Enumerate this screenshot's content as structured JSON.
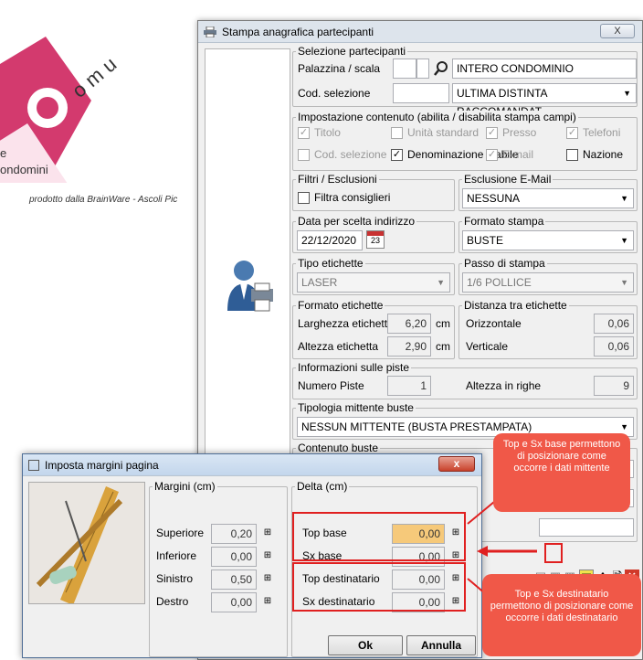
{
  "background": {
    "logo_letters": "o m u",
    "brand": "ondomini",
    "brand_prefix": "e",
    "tagline": "prodotto dalla BrainWare - Ascoli Pic"
  },
  "window": {
    "title": "Stampa anagrafica partecipanti",
    "close": "X"
  },
  "selezione": {
    "legend": "Selezione partecipanti",
    "palazzina_label": "Palazzina / scala",
    "palazzina_value": "INTERO CONDOMINIO",
    "cod_label": "Cod. selezione",
    "cod_value": "ULTIMA DISTINTA RACCOMANDAT"
  },
  "impostazione": {
    "legend": "Impostazione contenuto (abilita / disabilita stampa campi)",
    "items": [
      {
        "label": "Titolo",
        "checked": true,
        "enabled": false
      },
      {
        "label": "Unità standard",
        "checked": false,
        "enabled": false
      },
      {
        "label": "Presso",
        "checked": true,
        "enabled": false
      },
      {
        "label": "Telefoni",
        "checked": true,
        "enabled": false
      },
      {
        "label": "Cod. selezione",
        "checked": false,
        "enabled": false
      },
      {
        "label": "Denominazione stabile",
        "checked": true,
        "enabled": true
      },
      {
        "label": "E-mail",
        "checked": true,
        "enabled": false
      },
      {
        "label": "Nazione",
        "checked": false,
        "enabled": true
      }
    ]
  },
  "filtri": {
    "legend": "Filtri / Esclusioni",
    "consiglieri": "Filtra consiglieri"
  },
  "esclusione": {
    "legend": "Esclusione E-Mail",
    "value": "NESSUNA"
  },
  "data": {
    "legend": "Data per scelta indirizzo",
    "value": "22/12/2020",
    "cal": "23"
  },
  "formato_stampa": {
    "legend": "Formato stampa",
    "value": "BUSTE"
  },
  "tipo_etichette": {
    "legend": "Tipo etichette",
    "value": "LASER"
  },
  "passo": {
    "legend": "Passo di stampa",
    "value": "1/6 POLLICE"
  },
  "formato_etichette": {
    "legend": "Formato etichette",
    "larghezza_label": "Larghezza etichetta",
    "larghezza": "6,20",
    "altezza_label": "Altezza etichetta",
    "altezza": "2,90",
    "unit": "cm"
  },
  "distanza": {
    "legend": "Distanza tra etichette",
    "orizzontale_label": "Orizzontale",
    "orizzontale": "0,06",
    "verticale_label": "Verticale",
    "verticale": "0,06"
  },
  "piste": {
    "legend": "Informazioni sulle piste",
    "numero_label": "Numero Piste",
    "numero": "1",
    "altezza_label": "Altezza in righe",
    "altezza": "9"
  },
  "tipologia": {
    "legend": "Tipologia mittente buste",
    "value": "NESSUN MITTENTE (BUSTA PRESTAMPATA)"
  },
  "contenuto": {
    "legend": "Contenuto buste"
  },
  "dialog": {
    "title": "Imposta margini pagina",
    "close": "x",
    "margini_legend": "Margini (cm)",
    "margini": [
      {
        "label": "Superiore",
        "value": "0,20"
      },
      {
        "label": "Inferiore",
        "value": "0,00"
      },
      {
        "label": "Sinistro",
        "value": "0,50"
      },
      {
        "label": "Destro",
        "value": "0,00"
      }
    ],
    "delta_legend": "Delta (cm)",
    "delta": [
      {
        "label": "Top base",
        "value": "0,00"
      },
      {
        "label": "Sx base",
        "value": "0,00"
      },
      {
        "label": "Top destinatario",
        "value": "0,00"
      },
      {
        "label": "Sx destinatario",
        "value": "0,00"
      }
    ],
    "ok": "Ok",
    "annulla": "Annulla"
  },
  "callouts": {
    "top": "Top e Sx base permettono di posizionare come occorre i dati mittente",
    "bottom": "Top e Sx destinatario permettono di posizionare come occorre i dati destinatario"
  },
  "colors": {
    "accent_red": "#e02020",
    "callout": "#f05848",
    "highlight": "#f6c97a"
  }
}
